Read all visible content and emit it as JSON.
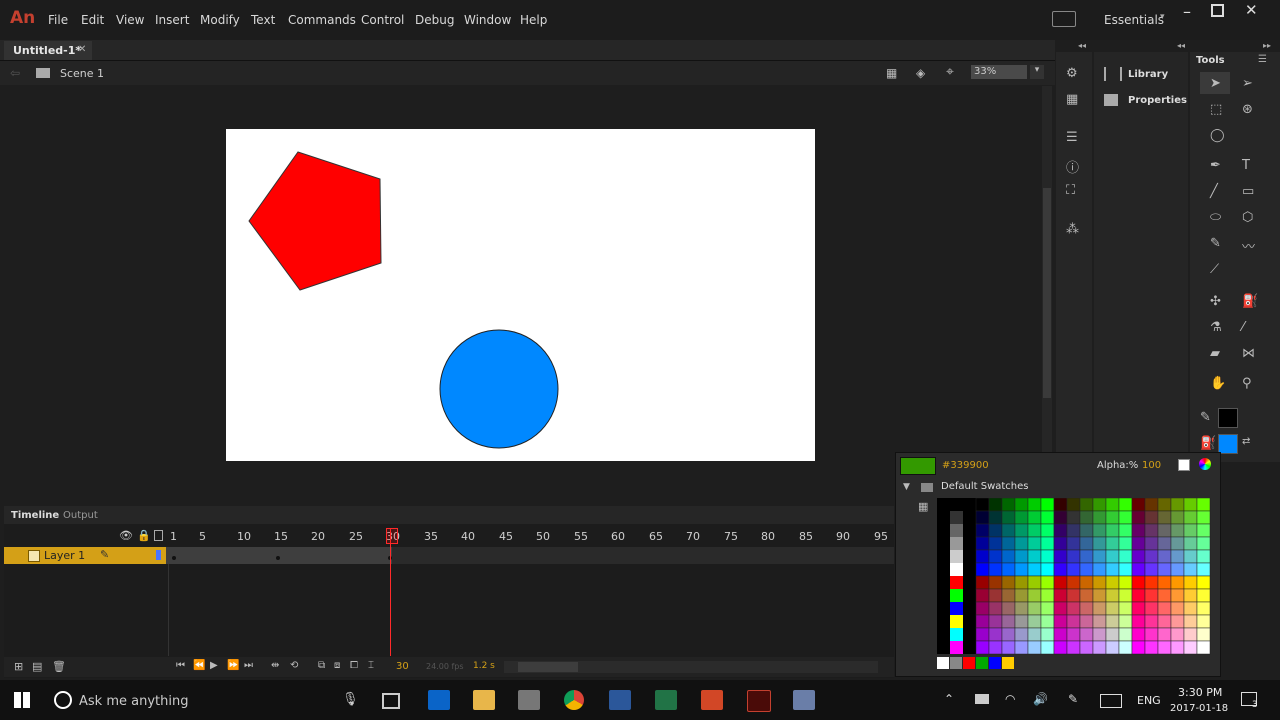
{
  "app": {
    "logo": "An"
  },
  "menu": [
    "File",
    "Edit",
    "View",
    "Insert",
    "Modify",
    "Text",
    "Commands",
    "Control",
    "Debug",
    "Window",
    "Help"
  ],
  "workspace": "Essentials",
  "document": {
    "tab": "Untitled-1*",
    "scene": "Scene 1",
    "zoom": "33%"
  },
  "shapes": {
    "pentagon_color": "#ff0000",
    "circle_color": "#0088ff"
  },
  "panels": {
    "library": "Library",
    "properties": "Properties",
    "tools": "Tools"
  },
  "timeline": {
    "tabs": [
      "Timeline",
      "Output"
    ],
    "layer": "Layer 1",
    "frame_numbers": [
      "1",
      "5",
      "10",
      "15",
      "20",
      "25",
      "30",
      "35",
      "40",
      "45",
      "50",
      "55",
      "60",
      "65",
      "70",
      "75",
      "80",
      "85",
      "90",
      "95"
    ],
    "current_frame": "30",
    "fps": "24.00 fps",
    "time": "1.2 s"
  },
  "swatches": {
    "hex": "#339900",
    "alpha_label": "Alpha:%",
    "alpha_value": "100",
    "title": "Default Swatches",
    "current_color": "#339900"
  },
  "taskbar": {
    "search_placeholder": "Ask me anything",
    "lang": "ENG",
    "time": "3:30 PM",
    "date": "2017-01-18",
    "notifications": "3"
  }
}
